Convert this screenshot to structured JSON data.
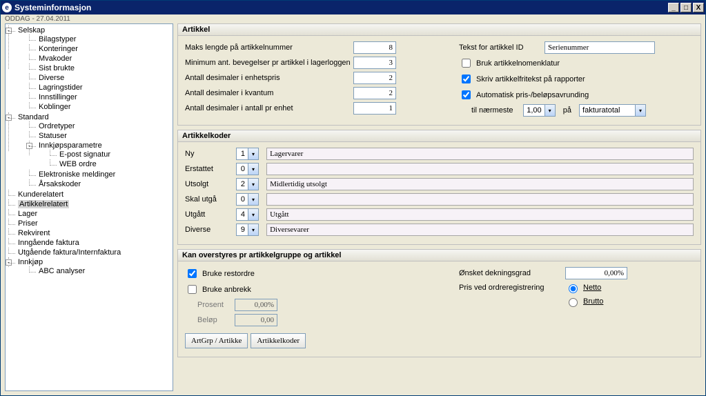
{
  "window": {
    "title": "Systeminformasjon",
    "subtext": "ODDAG - 27.04.2011"
  },
  "tree": {
    "root": "Selskap",
    "selskap_children": [
      "Bilagstyper",
      "Konteringer",
      "Mvakoder",
      "Sist brukte",
      "Diverse",
      "Lagringstider",
      "Innstillinger",
      "Koblinger"
    ],
    "standard": "Standard",
    "standard_children": [
      "Ordretyper",
      "Statuser"
    ],
    "innkjopsparam": "Innkjøpsparametre",
    "innkjopsparam_children": [
      "E-post signatur",
      "WEB ordre"
    ],
    "standard_tail": [
      "Elektroniske meldinger",
      "Årsakskoder"
    ],
    "level1_tail": [
      "Kunderelatert",
      "Artikkelrelatert",
      "Lager",
      "Priser",
      "Rekvirent",
      "Inngående faktura",
      "Utgående faktura/Internfaktura"
    ],
    "innkjop": "Innkjøp",
    "innkjop_children": [
      "ABC analyser"
    ],
    "selected": "Artikkelrelatert"
  },
  "artikkel": {
    "header": "Artikkel",
    "rows": [
      {
        "label": "Maks lengde på artikkelnummer",
        "value": "8"
      },
      {
        "label": "Minimum ant. bevegelser pr artikkel i lagerloggen",
        "value": "3"
      },
      {
        "label": "Antall desimaler i enhetspris",
        "value": "2"
      },
      {
        "label": "Antall desimaler i kvantum",
        "value": "2"
      },
      {
        "label": "Antall desimaler i antall pr enhet",
        "value": "1"
      }
    ],
    "right": {
      "tekst_label": "Tekst for artikkel ID",
      "tekst_value": "Serienummer",
      "chk_nomenklatur": "Bruk artikkelnomenklatur",
      "chk_fritekst": "Skriv artikkelfritekst på rapporter",
      "chk_avrunding": "Automatisk pris-/beløpsavrunding",
      "til_naermeste": "til nærmeste",
      "naermeste_val": "1,00",
      "paa": "på",
      "paa_val": "fakturatotal"
    }
  },
  "artikkelkoder": {
    "header": "Artikkelkoder",
    "rows": [
      {
        "label": "Ny",
        "num": "1",
        "text": "Lagervarer"
      },
      {
        "label": "Erstattet",
        "num": "0",
        "text": ""
      },
      {
        "label": "Utsolgt",
        "num": "2",
        "text": "Midlertidig utsolgt"
      },
      {
        "label": "Skal utgå",
        "num": "0",
        "text": ""
      },
      {
        "label": "Utgått",
        "num": "4",
        "text": "Utgått"
      },
      {
        "label": "Diverse",
        "num": "9",
        "text": "Diversevarer"
      }
    ]
  },
  "overstyres": {
    "header": "Kan overstyres pr artikkelgruppe og artikkel",
    "chk_restordre": "Bruke restordre",
    "chk_anbrekk": "Bruke anbrekk",
    "prosent_label": "Prosent",
    "prosent_value": "0,00%",
    "belop_label": "Beløp",
    "belop_value": "0,00",
    "onsket_label": "Ønsket dekningsgrad",
    "onsket_value": "0,00%",
    "pris_label": "Pris ved ordreregistrering",
    "radio_netto": "Netto",
    "radio_brutto": "Brutto",
    "btn_artgrp": "ArtGrp / Artikke",
    "btn_koder": "Artikkelkoder"
  }
}
